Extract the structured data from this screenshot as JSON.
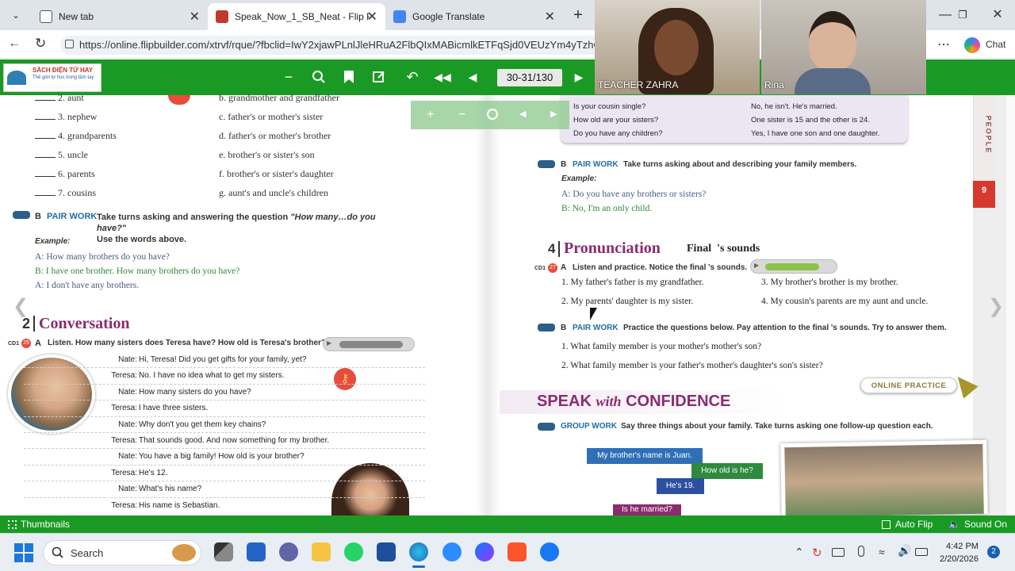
{
  "browser": {
    "tabs": [
      {
        "title": "New tab"
      },
      {
        "title": "Speak_Now_1_SB_Neat - Flip PDF"
      },
      {
        "title": "Google Translate"
      }
    ],
    "url": "https://online.flipbuilder.com/xtrvf/rque/?fbclid=IwY2xjawPLnlJleHRuA2FlbQIxMABicmlkETFqSjd0VEUzYm4yTzhC",
    "chat_label": "Chat"
  },
  "toolbar": {
    "page_indicator": "30-31/130"
  },
  "logo": {
    "title": "SÁCH ĐIỆN TỬ HAY",
    "tagline": "Thế giới tự học trong tầm tay"
  },
  "video": {
    "left_name": "TEACHER ZAHRA",
    "right_name": "Rina"
  },
  "left_page": {
    "matching": [
      {
        "num": "2.",
        "word": "aunt",
        "def": "b. grandmother and grandfather"
      },
      {
        "num": "3.",
        "word": "nephew",
        "def": "c. father's or mother's sister"
      },
      {
        "num": "4.",
        "word": "grandparents",
        "def": "d. father's or mother's brother"
      },
      {
        "num": "5.",
        "word": "uncle",
        "def": "e. brother's or sister's son"
      },
      {
        "num": "6.",
        "word": "parents",
        "def": "f. brother's or sister's daughter"
      },
      {
        "num": "7.",
        "word": "cousins",
        "def": "g. aunt's and uncle's children"
      }
    ],
    "pairwork_letter": "B",
    "pairwork_label": "PAIR WORK",
    "pairwork_text": "Take turns asking and answering the question",
    "pairwork_question": "\"How many…do you have?\"",
    "pairwork_text2": "Use the words above.",
    "example_label": "Example:",
    "example": [
      {
        "sp": "A:",
        "line": "How many brothers do you have?"
      },
      {
        "sp": "B:",
        "line": "I have one brother. How many brothers do you have?"
      },
      {
        "sp": "A:",
        "line": "I don't have any brothers."
      }
    ],
    "section_num": "2",
    "section_title": "Conversation",
    "cd": "CD1",
    "cd_track": "25",
    "letter": "A",
    "instruction": "Listen. How many sisters does Teresa have? How old is Teresa's brother?",
    "dialogue": [
      {
        "sp": "Nate:",
        "line": "Hi, Teresa! Did you get gifts for your family, yet?"
      },
      {
        "sp": "Teresa:",
        "line": "No. I have no idea what to get my sisters."
      },
      {
        "sp": "Nate:",
        "line": "How many sisters do you have?"
      },
      {
        "sp": "Teresa:",
        "line": "I have three sisters."
      },
      {
        "sp": "Nate:",
        "line": "Why don't you get them key chains?"
      },
      {
        "sp": "Teresa:",
        "line": "That sounds good. And now something for my brother."
      },
      {
        "sp": "Nate:",
        "line": "You have a big family! How old is your brother?"
      },
      {
        "sp": "Teresa:",
        "line": "He's 12."
      },
      {
        "sp": "Nate:",
        "line": "What's his name?"
      },
      {
        "sp": "Teresa:",
        "line": "His name is Sebastian."
      }
    ]
  },
  "right_page": {
    "box": {
      "q": [
        "Is your cousin single?",
        "How old are your sisters?",
        "Do you have any children?"
      ],
      "a": [
        "No, he isn't. He's married.",
        "One sister is 15 and the other is 24.",
        "Yes, I have one son and one daughter."
      ]
    },
    "side_tab": "PEOPLE",
    "side_num": "9",
    "pw_letter": "B",
    "pw_label": "PAIR WORK",
    "pw_text": "Take turns asking about and describing your family members.",
    "example_label": "Example:",
    "example": [
      {
        "sp": "A:",
        "line": "Do you have any brothers or sisters?"
      },
      {
        "sp": "B:",
        "line": "No, I'm an only child."
      }
    ],
    "section_num": "4",
    "section_title": "Pronunciation",
    "section_sub": "Final  's sounds",
    "cd": "CD1",
    "cd_track": "27",
    "a_letter": "A",
    "a_text": "Listen and practice. Notice the final 's sounds.",
    "sentences": [
      "1. My father's father is my grandfather.",
      "2. My parents' daughter is my sister.",
      "3. My brother's brother is my brother.",
      "4. My cousin's parents are my aunt and uncle."
    ],
    "b_letter": "B",
    "b_label": "PAIR WORK",
    "b_text": "Practice the questions below. Pay attention to the final 's sounds. Try to answer them.",
    "questions": [
      "1. What family member is your mother's mother's son?",
      "2. What family member is your father's mother's daughter's son's sister?"
    ],
    "online_practice": "ONLINE PRACTICE",
    "speak_title": {
      "a": "SPEAK",
      "b": "with",
      "c": "CONFIDENCE"
    },
    "gw_label": "GROUP WORK",
    "gw_text": "Say three things about your family. Take turns asking one follow-up question each.",
    "bubbles": [
      "My brother's name is Juan.",
      "How old is he?",
      "He's 19.",
      "Is he married?"
    ]
  },
  "bottom": {
    "thumbnails": "Thumbnails",
    "autoflip": "Auto Flip",
    "sound": "Sound On"
  },
  "taskbar": {
    "search": "Search",
    "time": "4:42 PM",
    "date": "2/20/2026",
    "notif": "2"
  }
}
